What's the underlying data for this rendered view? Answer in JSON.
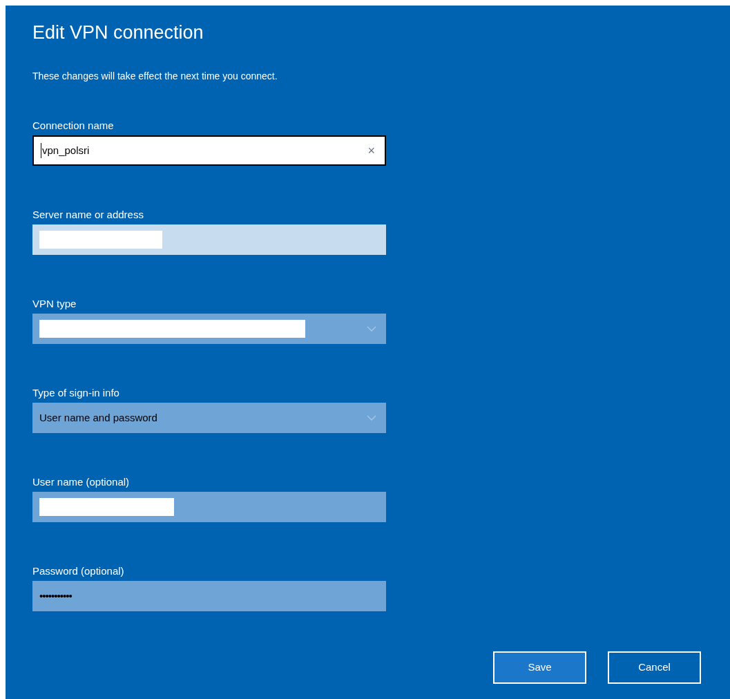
{
  "dialog": {
    "title": "Edit VPN connection",
    "description": "These changes will take effect the next time you connect.",
    "fields": [
      {
        "label": "Connection name",
        "kind": "text",
        "value": "vpn_polsri",
        "focused": true,
        "hovered": false,
        "redacted": false,
        "clear_button": "×"
      },
      {
        "label": "Server name or address",
        "kind": "text",
        "focused": false,
        "hovered": true,
        "redacted": true
      },
      {
        "label": "VPN type",
        "kind": "dropdown",
        "focused": false,
        "hovered": false,
        "redacted": true
      },
      {
        "label": "Type of sign-in info",
        "kind": "dropdown",
        "value": "User name and password",
        "focused": false,
        "hovered": false,
        "redacted": false
      },
      {
        "label": "User name (optional)",
        "kind": "text",
        "focused": false,
        "hovered": false,
        "redacted": true
      },
      {
        "label": "Password (optional)",
        "kind": "password",
        "value": "•••••••••••",
        "focused": false,
        "hovered": false,
        "redacted": false
      }
    ],
    "buttons": [
      {
        "label": "Save",
        "default": true
      },
      {
        "label": "Cancel",
        "default": false
      }
    ]
  }
}
